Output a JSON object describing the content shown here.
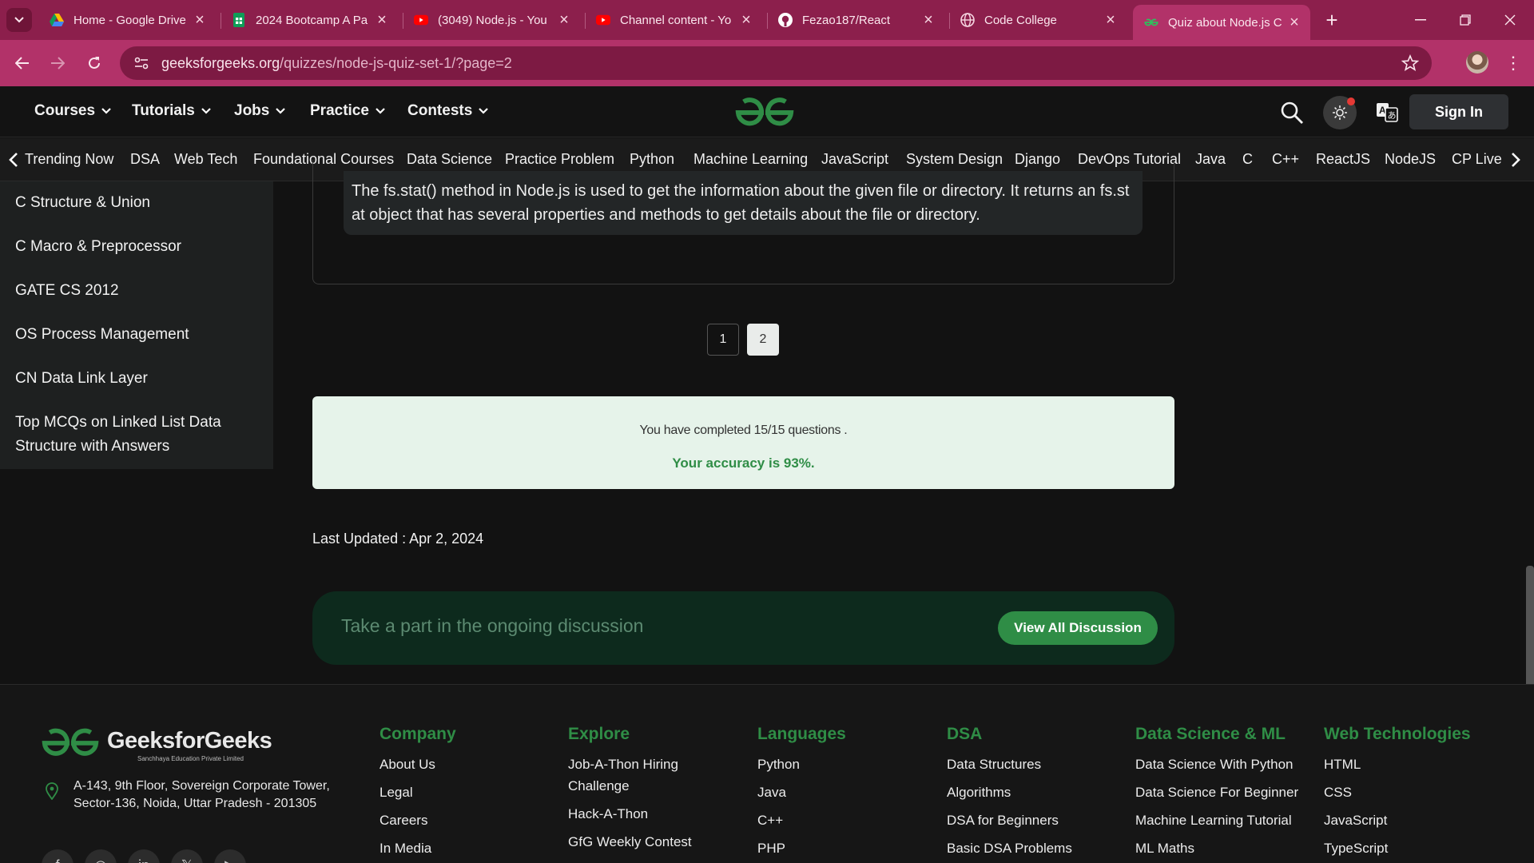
{
  "browser": {
    "tabs": [
      {
        "title": "Home - Google Drive",
        "icon": "google-drive-icon"
      },
      {
        "title": "2024 Bootcamp A Pa",
        "icon": "google-sheets-icon"
      },
      {
        "title": "(3049) Node.js - You",
        "icon": "youtube-icon"
      },
      {
        "title": "Channel content - Yo",
        "icon": "youtube-icon"
      },
      {
        "title": "Fezao187/React",
        "icon": "github-icon"
      },
      {
        "title": "Code College",
        "icon": "globe-icon"
      },
      {
        "title": "Quiz about Node.js C",
        "icon": "gfg-icon",
        "active": true
      }
    ],
    "url_domain": "geeksforgeeks.org",
    "url_path": "/quizzes/node-js-quiz-set-1/?page=2"
  },
  "header": {
    "nav": [
      "Courses",
      "Tutorials",
      "Jobs",
      "Practice",
      "Contests"
    ],
    "sign_in": "Sign In"
  },
  "subnav": [
    "Trending Now",
    "DSA",
    "Web Tech",
    "Foundational Courses",
    "Data Science",
    "Practice Problem",
    "Python",
    "Machine Learning",
    "JavaScript",
    "System Design",
    "Django",
    "DevOps Tutorial",
    "Java",
    "C",
    "C++",
    "ReactJS",
    "NodeJS",
    "CP Live"
  ],
  "sidebar": {
    "items": [
      "C Structure & Union",
      "C Macro & Preprocessor",
      "GATE CS 2012",
      "OS Process Management",
      "CN Data Link Layer",
      "Top MCQs on Linked List Data Structure with Answers"
    ]
  },
  "explanation": "The fs.stat() method in Node.js is used to get the information about the given file or directory. It returns an fs.stat object that has several properties and methods to get details about the file or directory.",
  "pagination": {
    "pages": [
      "1",
      "2"
    ],
    "current": "2"
  },
  "result": {
    "completed": "You have completed 15/15 questions .",
    "accuracy": "Your accuracy is 93%."
  },
  "last_updated": "Last Updated : Apr 2, 2024",
  "discussion": {
    "prompt": "Take a part in the ongoing discussion",
    "button": "View All Discussion"
  },
  "footer": {
    "brand": "GeeksforGeeks",
    "tagline": "Sanchhaya Education Private Limited",
    "address": "A-143, 9th Floor, Sovereign Corporate Tower, Sector-136, Noida, Uttar Pradesh - 201305",
    "columns": [
      {
        "title": "Company",
        "links": [
          "About Us",
          "Legal",
          "Careers",
          "In Media"
        ]
      },
      {
        "title": "Explore",
        "links": [
          "Job-A-Thon Hiring Challenge",
          "Hack-A-Thon",
          "GfG Weekly Contest"
        ]
      },
      {
        "title": "Languages",
        "links": [
          "Python",
          "Java",
          "C++",
          "PHP"
        ]
      },
      {
        "title": "DSA",
        "links": [
          "Data Structures",
          "Algorithms",
          "DSA for Beginners",
          "Basic DSA Problems"
        ]
      },
      {
        "title": "Data Science & ML",
        "links": [
          "Data Science With Python",
          "Data Science For Beginner",
          "Machine Learning Tutorial",
          "ML Maths"
        ]
      },
      {
        "title": "Web Technologies",
        "links": [
          "HTML",
          "CSS",
          "JavaScript",
          "TypeScript"
        ]
      }
    ]
  },
  "colors": {
    "brand_green": "#2f8d46",
    "browser_accent": "#b23269",
    "result_bg": "#e6f3ea"
  }
}
